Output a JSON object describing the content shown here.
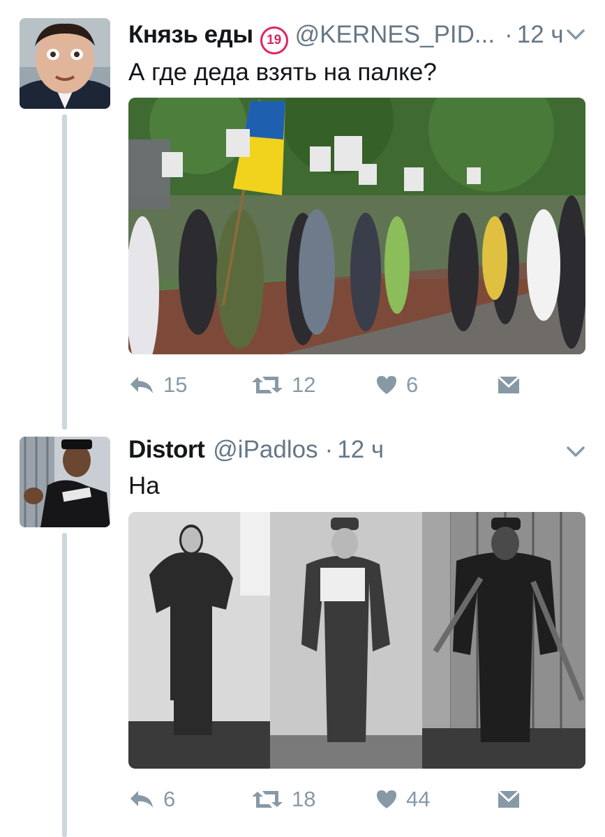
{
  "tweets": [
    {
      "display_name": "Князь еды",
      "badge": "19",
      "handle": "@KERNES_PID...",
      "separator": "·",
      "time": "12 ч",
      "text": "А где деда взять на палке?",
      "media_description": "photo of a street march with a Ukrainian flag and portraits",
      "counts": {
        "reply": "15",
        "retweet": "12",
        "like": "6"
      },
      "icons": [
        "reply-icon",
        "retweet-icon",
        "heart-icon",
        "message-icon"
      ]
    },
    {
      "display_name": "Distort",
      "handle": "@iPadlos",
      "separator": "·",
      "time": "12 ч",
      "text": "На",
      "media_description": "three black-and-white archive photos of standing men",
      "counts": {
        "reply": "6",
        "retweet": "18",
        "like": "44"
      },
      "icons": [
        "reply-icon",
        "retweet-icon",
        "heart-icon",
        "message-icon"
      ]
    }
  ],
  "colors": {
    "name": "#14171a",
    "secondary": "#657786",
    "action": "#8899a6",
    "thread_line": "#ccd6dd",
    "badge": "#e0245e"
  }
}
